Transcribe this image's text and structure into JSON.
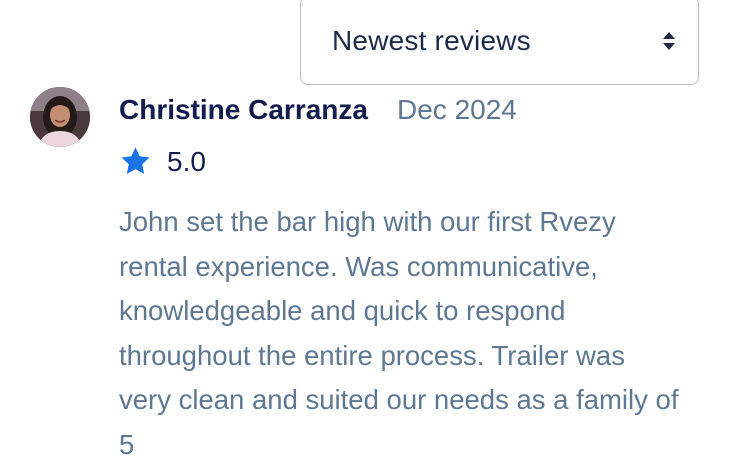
{
  "sort": {
    "selected": "Newest reviews",
    "arrows_icon": "sort-updown-icon"
  },
  "review": {
    "avatar_icon": "reviewer-avatar",
    "reviewer_name": "Christine Carranza",
    "date": "Dec 2024",
    "rating_icon": "star-icon",
    "rating": "5.0",
    "text": "John set the bar high with our first Rvezy rental experience. Was communicative, knowledgeable and quick to respond throughout the entire process. Trailer was very clean and suited our needs as a family of 5"
  },
  "colors": {
    "name": "#141b4d",
    "muted_text": "#5f7891",
    "star": "#1a73e8",
    "border": "#b9bec6"
  }
}
